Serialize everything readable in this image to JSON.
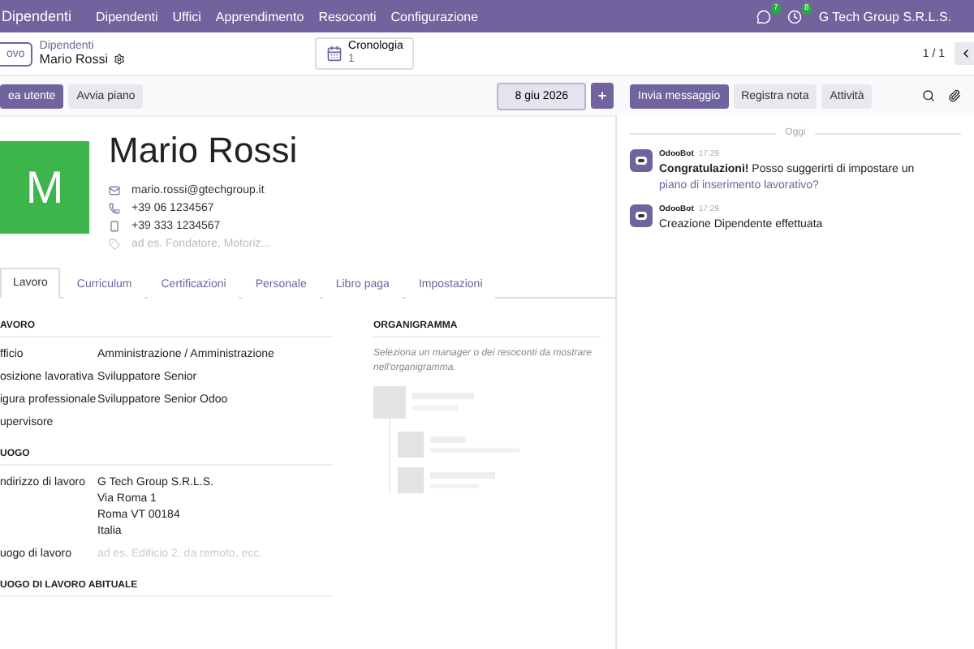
{
  "navbar": {
    "app": "Dipendenti",
    "menu": [
      "Dipendenti",
      "Uffici",
      "Apprendimento",
      "Resoconti",
      "Configurazione"
    ],
    "indicators": [
      {
        "kind": "chat",
        "count": "7"
      },
      {
        "kind": "activity",
        "count": "8"
      }
    ],
    "company": "G Tech Group S.R.L.S."
  },
  "breadcrumb": {
    "new_button": "ovo",
    "parent": "Dipendenti",
    "current": "Mario Rossi"
  },
  "smart_button": {
    "label": "Cronologia",
    "value": "1"
  },
  "pager": "1 / 1",
  "actions": [
    {
      "label": "ea utente",
      "kind": "primary"
    },
    {
      "label": "Avvia piano",
      "kind": "secondary"
    }
  ],
  "date": "8 giu 2026",
  "add_button": "+",
  "employee": {
    "avatar_letter": "M",
    "name": "Mario Rossi",
    "contacts": [
      {
        "kind": "email",
        "value": "mario.rossi@gtechgroup.it"
      },
      {
        "kind": "phone",
        "value": "+39 06 1234567"
      },
      {
        "kind": "mobile",
        "value": "+39 333 1234567"
      },
      {
        "kind": "tags",
        "placeholder": "ad es. Fondatore, Motoriz..."
      }
    ]
  },
  "tabs": [
    {
      "label": "Lavoro",
      "selected": true
    },
    {
      "label": "Curriculum",
      "selected": false
    },
    {
      "label": "Certificazioni",
      "selected": false
    },
    {
      "label": "Personale",
      "selected": false
    },
    {
      "label": "Libro paga",
      "selected": false
    },
    {
      "label": "Impostazioni",
      "selected": false
    }
  ],
  "sections": [
    {
      "title": "AVORO",
      "fields": [
        {
          "label": "fficio",
          "value": [
            "Amministrazione / Amministrazione"
          ]
        },
        {
          "label": "osizione lavorativa",
          "value": [
            "Sviluppatore Senior"
          ]
        },
        {
          "label": "igura professionale",
          "value": [
            "Sviluppatore Senior Odoo"
          ]
        },
        {
          "label": "upervisore"
        }
      ]
    },
    {
      "title": "UOGO",
      "fields": [
        {
          "label": "ndirizzo di lavoro",
          "value": [
            "G Tech Group S.R.L.S.",
            "Via Roma 1",
            "Roma VT 00184",
            "Italia"
          ]
        },
        {
          "label": "uogo di lavoro",
          "placeholder": "ad es. Edificio 2, da remoto, ecc."
        }
      ]
    },
    {
      "title": "UOGO DI LAVORO ABITUALE"
    }
  ],
  "org_chart": {
    "title": "ORGANIGRAMMA",
    "hint": "Seleziona un manager o dei resoconti da mostrare nell'organigramma."
  },
  "chatter": {
    "buttons": [
      {
        "label": "Invia messaggio",
        "kind": "primary"
      },
      {
        "label": "Registra nota",
        "kind": "secondary"
      },
      {
        "label": "Attività",
        "kind": "secondary"
      }
    ],
    "date_divider": "Oggi",
    "messages": [
      {
        "author": "OdooBot",
        "time": "17:29",
        "text": "**Congratulazioni!** Posso suggerirti di impostare un",
        "link": "piano di inserimento lavorativo?"
      },
      {
        "author": "OdooBot",
        "time": "17:29",
        "text": "Creazione Dipendente effettuata"
      }
    ]
  }
}
